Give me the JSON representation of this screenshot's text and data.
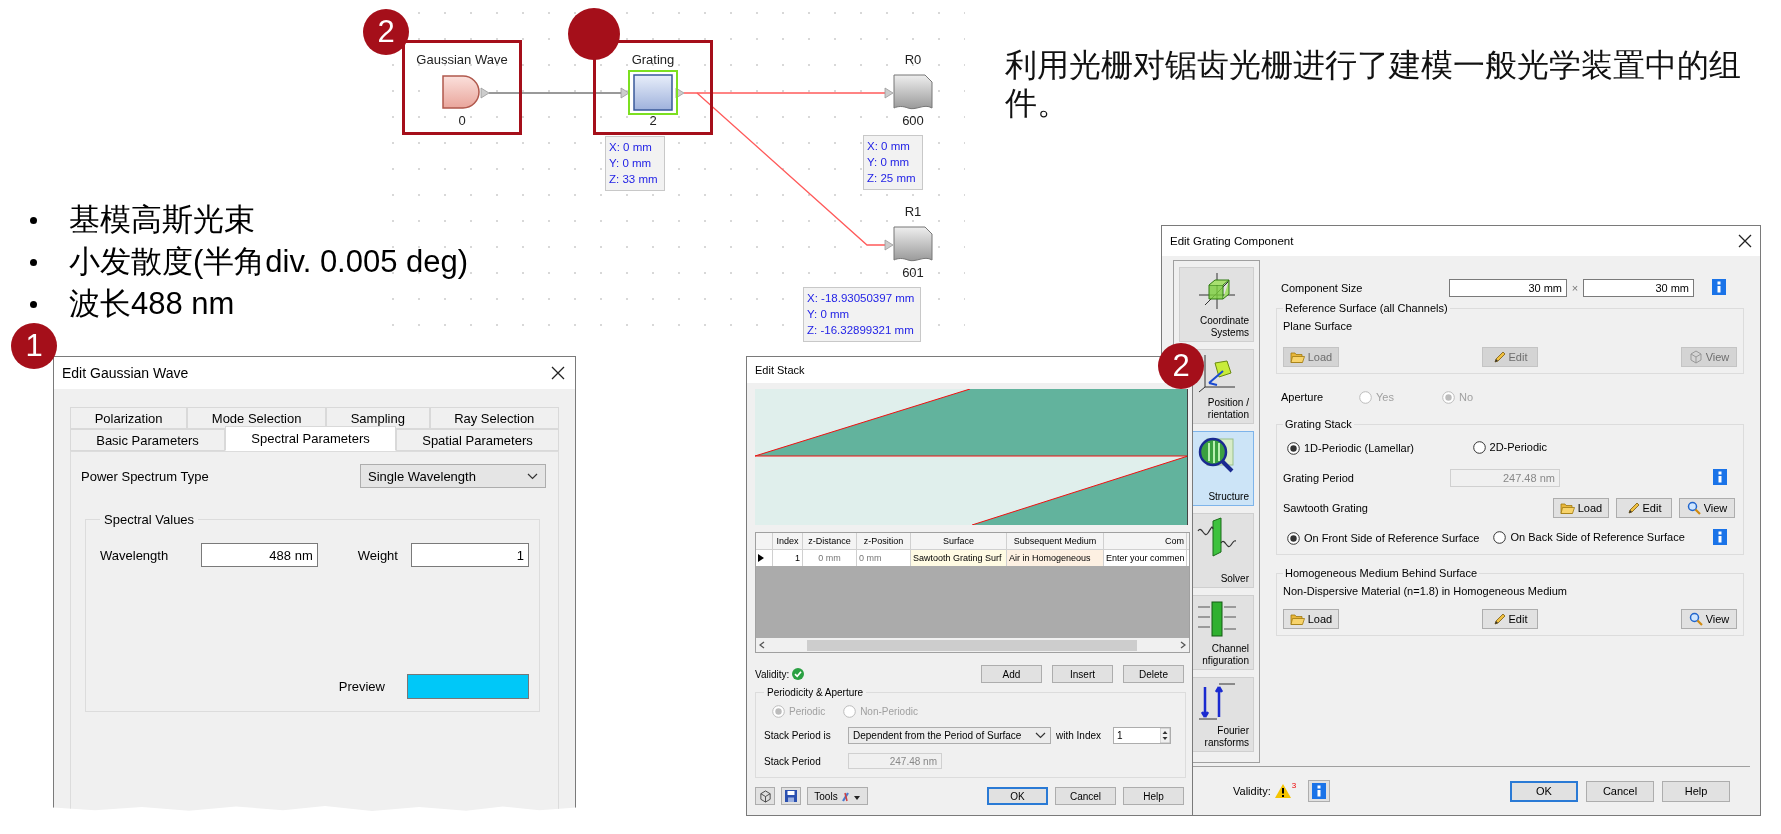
{
  "slide": {
    "description": "利用光栅对锯齿光栅进行了建模一般光学装置中的组件。",
    "bullets": [
      "基模高斯光束",
      "小发散度(半角div. 0.005 deg)",
      "波长488 nm"
    ]
  },
  "diagram": {
    "nodes": [
      {
        "kind": "source",
        "title": "Gaussian Wave",
        "index": "0",
        "highlighted": true,
        "selected": false
      },
      {
        "kind": "grating",
        "title": "Grating",
        "index": "2",
        "highlighted": true,
        "selected": true,
        "position": [
          "X: 0 mm",
          "Y: 0 mm",
          "Z: 33 mm"
        ]
      },
      {
        "kind": "detector",
        "title": "R0",
        "index": "600",
        "highlighted": false,
        "selected": false,
        "position": [
          "X: 0 mm",
          "Y: 0 mm",
          "Z: 25 mm"
        ]
      },
      {
        "kind": "detector",
        "title": "R1",
        "index": "601",
        "highlighted": false,
        "selected": false,
        "position": [
          "X: -18.93050397 mm",
          "Y: 0 mm",
          "Z: -16.32899321 mm"
        ]
      }
    ]
  },
  "gaussian_dialog": {
    "title": "Edit Gaussian Wave",
    "tab_rows": [
      [
        {
          "label": "Polarization",
          "selected": false
        },
        {
          "label": "Mode Selection",
          "selected": false
        },
        {
          "label": "Sampling",
          "selected": false
        },
        {
          "label": "Ray Selection",
          "selected": false
        }
      ],
      [
        {
          "label": "Basic Parameters",
          "selected": false
        },
        {
          "label": "Spectral Parameters",
          "selected": true
        },
        {
          "label": "Spatial Parameters",
          "selected": false
        }
      ]
    ],
    "power_spectrum_type": {
      "label": "Power Spectrum Type",
      "value": "Single Wavelength"
    },
    "spectral_values": {
      "title": "Spectral Values",
      "wavelength": {
        "label": "Wavelength",
        "value": "488 nm"
      },
      "weight": {
        "label": "Weight",
        "value": "1"
      },
      "preview": {
        "label": "Preview"
      }
    }
  },
  "stack_dialog": {
    "title": "Edit Stack",
    "table": {
      "columns": [
        "Index",
        "z-Distance",
        "z-Position",
        "Surface",
        "Subsequent Medium",
        "Com"
      ],
      "rows": [
        {
          "selected": true,
          "cells": [
            "1",
            "0 mm",
            "0 mm",
            "Sawtooth Grating Surf",
            "Air in Homogeneous",
            "Enter your commen"
          ]
        }
      ]
    },
    "validity": {
      "label": "Validity:",
      "valid": true
    },
    "buttons": [
      {
        "label": "Add"
      },
      {
        "label": "Insert"
      },
      {
        "label": "Delete"
      }
    ],
    "periodicity": {
      "title": "Periodicity & Aperture",
      "disabled": true,
      "options": [
        {
          "label": "Periodic",
          "selected": true
        },
        {
          "label": "Non-Periodic",
          "selected": false
        }
      ],
      "stack_period_is": {
        "label": "Stack Period is",
        "value": "Dependent from the Period of Surface"
      },
      "with_index": {
        "label": "with Index",
        "value": "1"
      },
      "stack_period": {
        "label": "Stack Period",
        "value": "247.48 nm"
      }
    },
    "footer": {
      "tools": "Tools",
      "buttons": [
        {
          "label": "OK",
          "default": true
        },
        {
          "label": "Cancel",
          "default": false
        },
        {
          "label": "Help",
          "default": false
        }
      ]
    }
  },
  "grating_dialog": {
    "title": "Edit Grating Component",
    "sidebar": [
      {
        "kind": "coordinates",
        "lines": [
          "Coordinate",
          "Systems"
        ],
        "selected": false
      },
      {
        "kind": "position",
        "lines": [
          "Position /",
          "rientation"
        ],
        "selected": false
      },
      {
        "kind": "structure",
        "lines": [
          "Structure"
        ],
        "selected": true
      },
      {
        "kind": "solver",
        "lines": [
          "Solver"
        ],
        "selected": false
      },
      {
        "kind": "channel",
        "lines": [
          "Channel",
          "nfiguration"
        ],
        "selected": false
      },
      {
        "kind": "fourier",
        "lines": [
          "Fourier",
          "ransforms"
        ],
        "selected": false
      }
    ],
    "component_size": {
      "label": "Component Size",
      "width": "30 mm",
      "times": "×",
      "height": "30 mm"
    },
    "reference_surface": {
      "title": "Reference Surface (all Channels)",
      "value": "Plane Surface",
      "buttons": [
        {
          "kind": "load",
          "label": "Load",
          "disabled": true
        },
        {
          "kind": "edit",
          "label": "Edit",
          "disabled": true
        },
        {
          "kind": "view3d",
          "label": "View",
          "disabled": true
        }
      ]
    },
    "aperture": {
      "label": "Aperture",
      "disabled": true,
      "options": [
        {
          "label": "Yes",
          "selected": false
        },
        {
          "label": "No",
          "selected": true
        }
      ]
    },
    "grating_stack": {
      "title": "Grating Stack",
      "periodicity_options": [
        {
          "label": "1D-Periodic (Lamellar)",
          "selected": true
        },
        {
          "label": "2D-Periodic",
          "selected": false
        }
      ],
      "grating_period": {
        "label": "Grating Period",
        "value": "247.48 nm"
      },
      "profile": {
        "label": "Sawtooth Grating",
        "buttons": [
          {
            "kind": "load",
            "label": "Load",
            "disabled": false
          },
          {
            "kind": "edit",
            "label": "Edit",
            "disabled": false
          },
          {
            "kind": "view",
            "label": "View",
            "disabled": false
          }
        ]
      },
      "side_options": [
        {
          "label": "On Front Side of Reference Surface",
          "selected": true
        },
        {
          "label": "On Back Side of Reference Surface",
          "selected": false
        }
      ]
    },
    "medium": {
      "title": "Homogeneous Medium Behind Surface",
      "value": "Non-Dispersive Material (n=1.8) in Homogeneous Medium",
      "buttons": [
        {
          "kind": "load",
          "label": "Load",
          "disabled": false
        },
        {
          "kind": "edit",
          "label": "Edit",
          "disabled": false
        },
        {
          "kind": "view",
          "label": "View",
          "disabled": false
        }
      ]
    },
    "footer": {
      "validity_label": "Validity:",
      "warning_count": "3",
      "buttons": [
        {
          "label": "OK",
          "default": true
        },
        {
          "label": "Cancel",
          "default": false
        },
        {
          "label": "Help",
          "default": false
        }
      ]
    }
  },
  "badges": [
    {
      "kind": "numbered",
      "label": "2"
    },
    {
      "kind": "plain"
    },
    {
      "kind": "numbered",
      "label": "1"
    },
    {
      "kind": "numbered",
      "label": "2"
    }
  ]
}
